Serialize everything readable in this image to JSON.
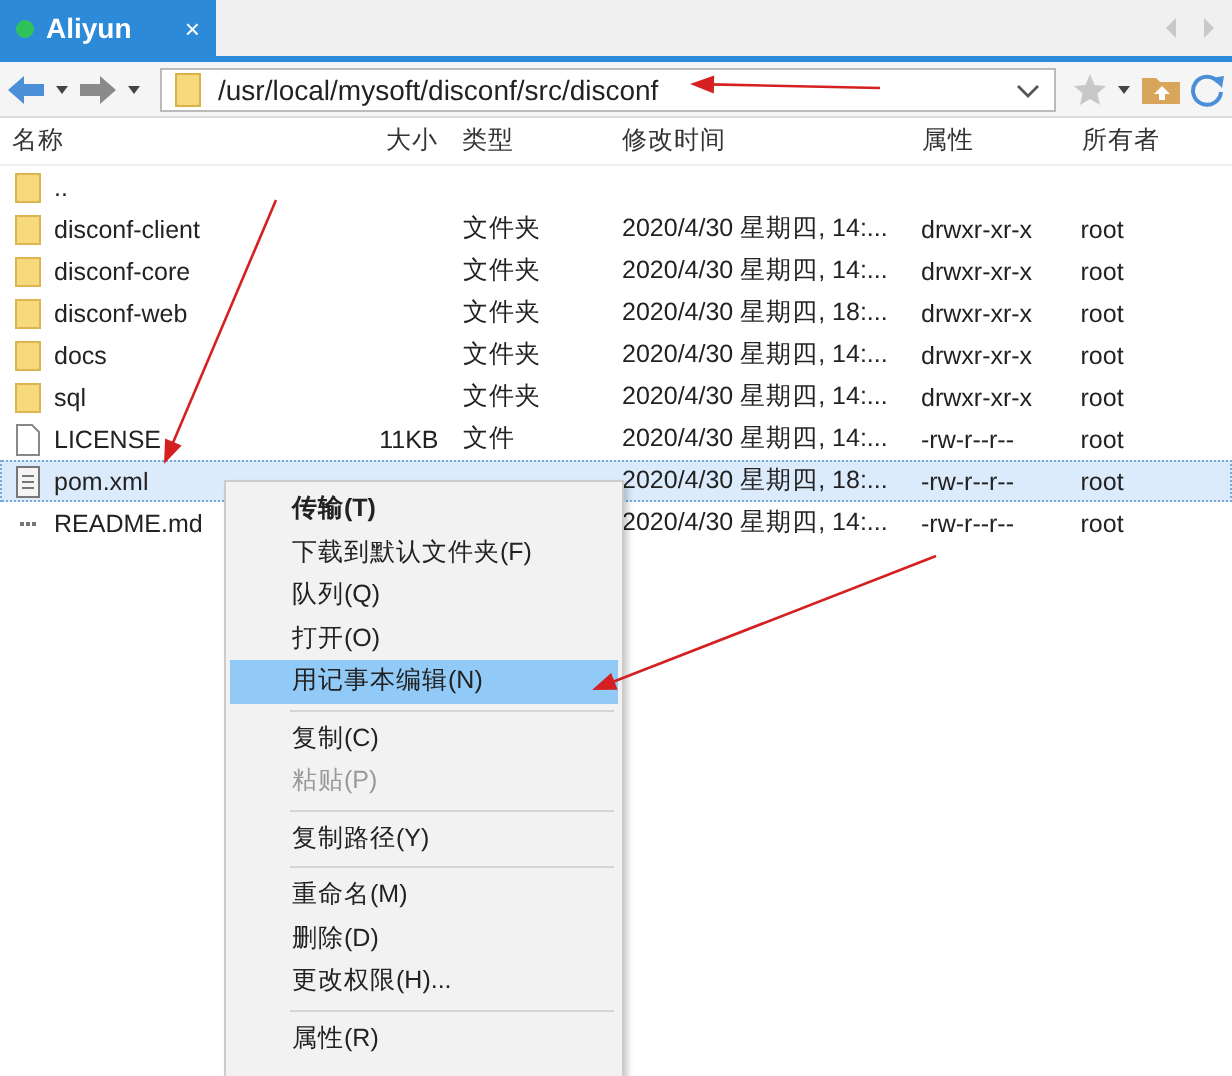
{
  "tab": {
    "title": "Aliyun",
    "close": "×",
    "selected": true
  },
  "address": {
    "path": "/usr/local/mysoft/disconf/src/disconf"
  },
  "columns": [
    "名称",
    "大小",
    "类型",
    "修改时间",
    "属性",
    "所有者"
  ],
  "rows": [
    {
      "kind": "parent",
      "name": "..",
      "size": "",
      "type": "",
      "time": "",
      "attr": "",
      "owner": "",
      "selected": false
    },
    {
      "kind": "folder",
      "name": "disconf-client",
      "size": "",
      "type": "文件夹",
      "time": "2020/4/30 星期四, 14:...",
      "attr": "drwxr-xr-x",
      "owner": "root",
      "selected": false
    },
    {
      "kind": "folder",
      "name": "disconf-core",
      "size": "",
      "type": "文件夹",
      "time": "2020/4/30 星期四, 14:...",
      "attr": "drwxr-xr-x",
      "owner": "root",
      "selected": false
    },
    {
      "kind": "folder",
      "name": "disconf-web",
      "size": "",
      "type": "文件夹",
      "time": "2020/4/30 星期四, 18:...",
      "attr": "drwxr-xr-x",
      "owner": "root",
      "selected": false
    },
    {
      "kind": "folder",
      "name": "docs",
      "size": "",
      "type": "文件夹",
      "time": "2020/4/30 星期四, 14:...",
      "attr": "drwxr-xr-x",
      "owner": "root",
      "selected": false
    },
    {
      "kind": "folder",
      "name": "sql",
      "size": "",
      "type": "文件夹",
      "time": "2020/4/30 星期四, 14:...",
      "attr": "drwxr-xr-x",
      "owner": "root",
      "selected": false
    },
    {
      "kind": "file",
      "name": "LICENSE",
      "size": "11KB",
      "type": "文件",
      "time": "2020/4/30 星期四, 14:...",
      "attr": "-rw-r--r--",
      "owner": "root",
      "selected": false
    },
    {
      "kind": "xml",
      "name": "pom.xml",
      "size": "",
      "type": "",
      "time": "2020/4/30 星期四, 18:...",
      "attr": "-rw-r--r--",
      "owner": "root",
      "selected": true
    },
    {
      "kind": "text",
      "name": "README.md",
      "size": "",
      "type": "",
      "time": "2020/4/30 星期四, 14:...",
      "attr": "-rw-r--r--",
      "owner": "root",
      "selected": false
    }
  ],
  "context_menu": [
    {
      "kind": "item",
      "label": "传输(T)",
      "bold": true,
      "disabled": false,
      "selected": false
    },
    {
      "kind": "item",
      "label": "下载到默认文件夹(F)",
      "bold": false,
      "disabled": false,
      "selected": false
    },
    {
      "kind": "item",
      "label": "队列(Q)",
      "bold": false,
      "disabled": false,
      "selected": false
    },
    {
      "kind": "item",
      "label": "打开(O)",
      "bold": false,
      "disabled": false,
      "selected": false
    },
    {
      "kind": "item",
      "label": "用记事本编辑(N)",
      "bold": false,
      "disabled": false,
      "selected": true
    },
    {
      "kind": "separator"
    },
    {
      "kind": "item",
      "label": "复制(C)",
      "bold": false,
      "disabled": false,
      "selected": false
    },
    {
      "kind": "item",
      "label": "粘贴(P)",
      "bold": false,
      "disabled": true,
      "selected": false
    },
    {
      "kind": "separator"
    },
    {
      "kind": "item",
      "label": "复制路径(Y)",
      "bold": false,
      "disabled": false,
      "selected": false
    },
    {
      "kind": "separator"
    },
    {
      "kind": "item",
      "label": "重命名(M)",
      "bold": false,
      "disabled": false,
      "selected": false
    },
    {
      "kind": "item",
      "label": "删除(D)",
      "bold": false,
      "disabled": false,
      "selected": false
    },
    {
      "kind": "item",
      "label": "更改权限(H)...",
      "bold": false,
      "disabled": false,
      "selected": false
    },
    {
      "kind": "separator"
    },
    {
      "kind": "item",
      "label": "属性(R)",
      "bold": false,
      "disabled": false,
      "selected": false
    }
  ]
}
